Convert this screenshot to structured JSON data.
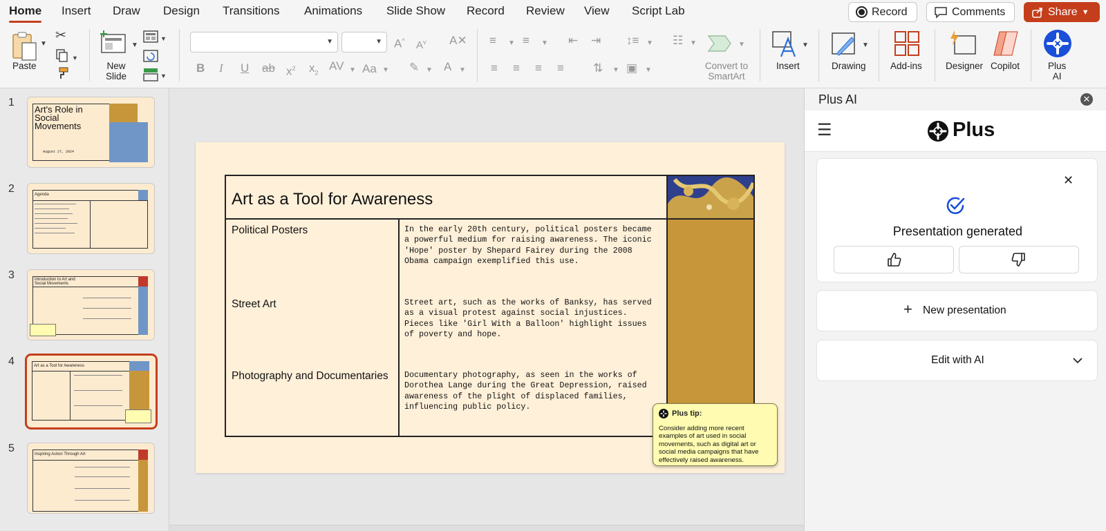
{
  "menu": {
    "tabs": [
      "Home",
      "Insert",
      "Draw",
      "Design",
      "Transitions",
      "Animations",
      "Slide Show",
      "Record",
      "Review",
      "View",
      "Script Lab"
    ],
    "active": "Home",
    "record_label": "Record",
    "comments_label": "Comments",
    "share_label": "Share"
  },
  "ribbon": {
    "paste": "Paste",
    "new_slide_line1": "New",
    "new_slide_line2": "Slide",
    "convert_line1": "Convert to",
    "convert_line2": "SmartArt",
    "insert": "Insert",
    "drawing": "Drawing",
    "addins": "Add-ins",
    "designer": "Designer",
    "copilot": "Copilot",
    "plusai_line1": "Plus",
    "plusai_line2": "AI",
    "font_name": "",
    "font_size": ""
  },
  "thumbnails": [
    {
      "num": "1",
      "title": "Art's Role in Social Movements",
      "date": "August 27, 2024"
    },
    {
      "num": "2",
      "title": "Agenda"
    },
    {
      "num": "3",
      "title": "Introduction to Art and Social Movements"
    },
    {
      "num": "4",
      "title": "Art as a Tool for Awareness"
    },
    {
      "num": "5",
      "title": "Inspiring Action Through Art"
    }
  ],
  "slide": {
    "title": "Art as a Tool for Awareness",
    "rows": [
      {
        "label": "Political Posters",
        "text": "In the early 20th century, political posters became a powerful medium for raising awareness. The iconic 'Hope' poster by Shepard Fairey during the 2008 Obama campaign exemplified this use."
      },
      {
        "label": "Street Art",
        "text": "Street art, such as the works of Banksy, has served as a visual protest against social injustices. Pieces like 'Girl With a Balloon' highlight issues of poverty and hope."
      },
      {
        "label": "Photography and Documentaries",
        "text": "Documentary photography, as seen in the works of Dorothea Lange during the Great Depression, raised awareness of the plight of displaced families, influencing public policy."
      }
    ],
    "tip_title": "Plus tip:",
    "tip_body": "Consider adding more recent examples of art used in social movements, such as digital art or social media campaigns that have effectively raised awareness."
  },
  "panel": {
    "title": "Plus AI",
    "brand": "Plus",
    "status": "Presentation generated",
    "new_presentation": "New presentation",
    "edit_with_ai": "Edit with AI"
  },
  "colors": {
    "accent": "#c43e1c",
    "slide_bg": "#fff0d9",
    "gold_panel": "#c8963a",
    "tip_bg": "#fffbb0",
    "plus_blue": "#1a4fd8"
  }
}
